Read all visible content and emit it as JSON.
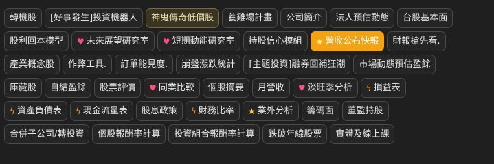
{
  "colors": {
    "background": "#1f1f1f",
    "tag_bg": "#252525",
    "tag_border": "#494949",
    "selected_bg": "#3a3523",
    "active_bg": "#f2a30f",
    "heart": "#ff4d7d",
    "bolt": "#ff9a2a",
    "star": "#ffd23a"
  },
  "icons": {
    "heart": "heart-icon",
    "bolt": "lightning-bolt-icon",
    "star": "star-icon"
  },
  "rows": [
    [
      "轉機股",
      "[好事發生]投資機器人",
      "神鬼傳奇低價股",
      "養雞場計畫",
      "公司簡介",
      "法人預估動態",
      "台股基本面"
    ],
    [
      "股利回本模型",
      "未來展望研究室",
      "短期動能研究室",
      "持股信心模組",
      "營收公布快報",
      "財報搶先看."
    ],
    [
      "產業概念股",
      "作弊工具.",
      "訂單能見度.",
      "崩盤漲跌統計",
      "[主題投資]融券回補狂潮",
      "市場動態預估盈餘"
    ],
    [
      "庫藏股",
      "自結盈餘",
      "股票評價",
      "同業比較",
      "個股摘要",
      "月營收",
      "淡旺季分析",
      "損益表"
    ],
    [
      "資產負債表",
      "現金流量表",
      "股息政策",
      "財務比率",
      "業外分析",
      "籌碼面",
      "董監持股"
    ],
    [
      "合併子公司/轉投資",
      "個股報酬率計算",
      "投資組合報酬率計算",
      "跌破年線股票",
      "實體及線上課"
    ]
  ]
}
